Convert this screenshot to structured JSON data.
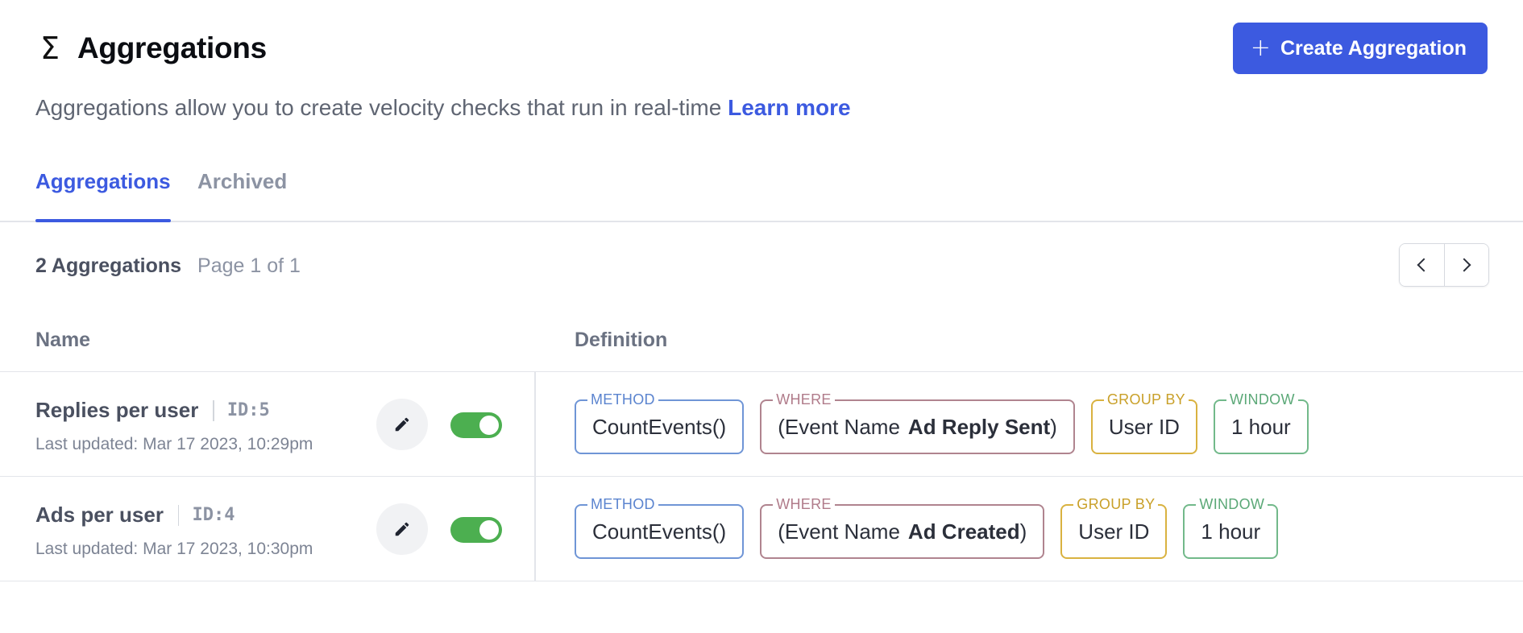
{
  "header": {
    "icon": "sigma-icon",
    "title": "Aggregations",
    "create_button": "Create Aggregation",
    "subtitle": "Aggregations allow you to create velocity checks that run in real-time",
    "learn_more": "Learn more"
  },
  "tabs": [
    {
      "label": "Aggregations",
      "active": true
    },
    {
      "label": "Archived",
      "active": false
    }
  ],
  "summary": {
    "count": "2 Aggregations",
    "page": "Page 1 of 1"
  },
  "table": {
    "columns": [
      "Name",
      "Definition"
    ],
    "rows": [
      {
        "name": "Replies per user",
        "id": "ID:5",
        "updated": "Last updated: Mar 17 2023, 10:29pm",
        "enabled": true,
        "definition": {
          "method_label": "METHOD",
          "method": "CountEvents()",
          "where_label": "WHERE",
          "where_prefix": "(Event Name",
          "where_event": "Ad Reply Sent",
          "where_suffix": ")",
          "group_label": "GROUP BY",
          "group": "User ID",
          "window_label": "WINDOW",
          "window": "1 hour"
        }
      },
      {
        "name": "Ads per user",
        "id": "ID:4",
        "updated": "Last updated: Mar 17 2023, 10:30pm",
        "enabled": true,
        "definition": {
          "method_label": "METHOD",
          "method": "CountEvents()",
          "where_label": "WHERE",
          "where_prefix": "(Event Name",
          "where_event": "Ad Created",
          "where_suffix": ")",
          "group_label": "GROUP BY",
          "group": "User ID",
          "window_label": "WINDOW",
          "window": "1 hour"
        }
      }
    ]
  },
  "colors": {
    "accent": "#3c5ae0",
    "toggle_on": "#4caf50",
    "method": "#6f95d6",
    "where": "#b0848f",
    "group_by": "#d9b240",
    "window": "#72b98a"
  }
}
